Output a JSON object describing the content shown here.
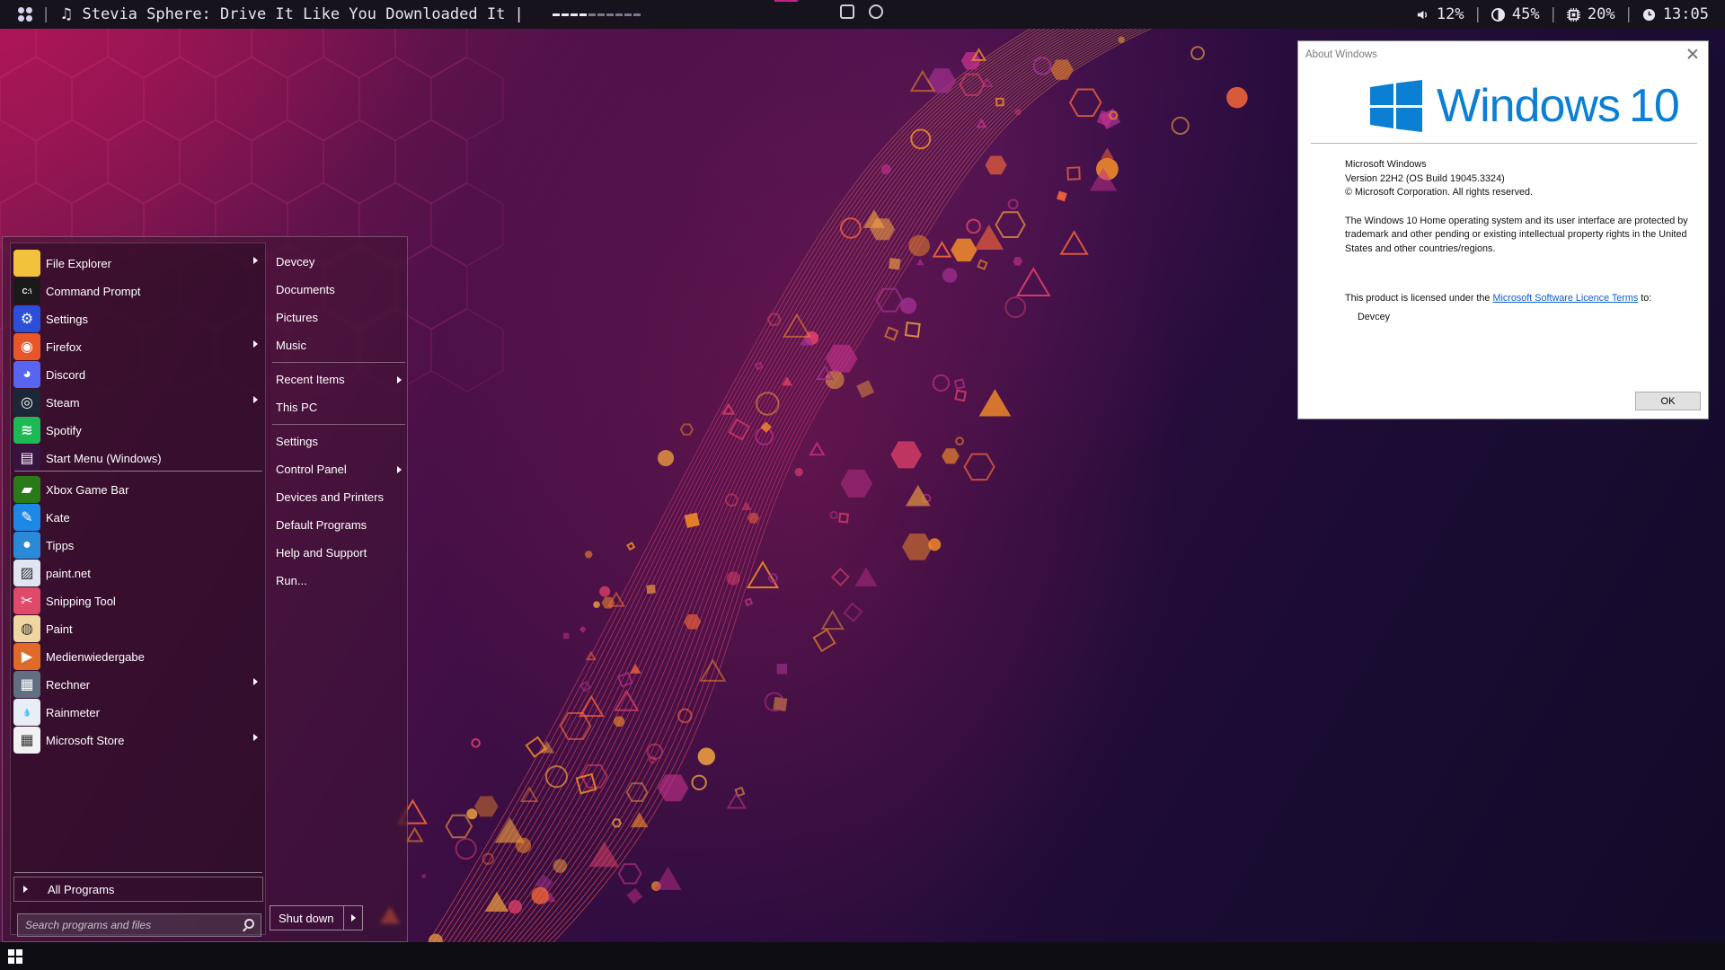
{
  "topbar": {
    "now_playing": "Stevia Sphere: Drive It Like You Downloaded It |",
    "progress": 0.4,
    "volume": "12%",
    "battery": "45%",
    "cpu": "20%",
    "clock": "13:05"
  },
  "start_menu": {
    "programs": [
      {
        "label": "File Explorer",
        "icon": "folder-icon",
        "submenu": true
      },
      {
        "label": "Command Prompt",
        "icon": "terminal-icon",
        "submenu": false
      },
      {
        "label": "Settings",
        "icon": "gear-icon",
        "submenu": false
      },
      {
        "label": "Firefox",
        "icon": "firefox-icon",
        "submenu": true
      },
      {
        "label": "Discord",
        "icon": "discord-icon",
        "submenu": false
      },
      {
        "label": "Steam",
        "icon": "steam-icon",
        "submenu": true
      },
      {
        "label": "Spotify",
        "icon": "spotify-icon",
        "submenu": false
      },
      {
        "label": "Start Menu (Windows)",
        "icon": "start-icon",
        "submenu": false
      },
      {
        "label": "Xbox Game Bar",
        "icon": "xbox-icon",
        "submenu": false
      },
      {
        "label": "Kate",
        "icon": "kate-icon",
        "submenu": false
      },
      {
        "label": "Tipps",
        "icon": "bulb-icon",
        "submenu": false
      },
      {
        "label": "paint.net",
        "icon": "paintnet-icon",
        "submenu": false
      },
      {
        "label": "Snipping Tool",
        "icon": "scissors-icon",
        "submenu": false
      },
      {
        "label": "Paint",
        "icon": "palette-icon",
        "submenu": false
      },
      {
        "label": "Medienwiedergabe",
        "icon": "play-icon",
        "submenu": false
      },
      {
        "label": "Rechner",
        "icon": "calculator-icon",
        "submenu": true
      },
      {
        "label": "Rainmeter",
        "icon": "drop-icon",
        "submenu": false
      },
      {
        "label": "Microsoft Store",
        "icon": "store-icon",
        "submenu": true
      }
    ],
    "all_programs": "All Programs",
    "search_placeholder": "Search programs and files",
    "places": [
      {
        "label": "Devcey",
        "submenu": false
      },
      {
        "label": "Documents",
        "submenu": false
      },
      {
        "label": "Pictures",
        "submenu": false
      },
      {
        "label": "Music",
        "submenu": false
      },
      {
        "label": "Recent Items",
        "submenu": true
      },
      {
        "label": "This PC",
        "submenu": false
      },
      {
        "label": "Settings",
        "submenu": false
      },
      {
        "label": "Control Panel",
        "submenu": true
      },
      {
        "label": "Devices and Printers",
        "submenu": false
      },
      {
        "label": "Default Programs",
        "submenu": false
      },
      {
        "label": "Help and Support",
        "submenu": false
      },
      {
        "label": "Run...",
        "submenu": false
      }
    ],
    "shutdown": "Shut down"
  },
  "about": {
    "title": "About Windows",
    "product": "Windows",
    "version_num": "10",
    "line1": "Microsoft Windows",
    "line2": "Version 22H2 (OS Build 19045.3324)",
    "line3": "© Microsoft Corporation. All rights reserved.",
    "protect": "The Windows 10 Home operating system and its user interface are protected by trademark and other pending or existing intellectual property rights in the United States and other countries/regions.",
    "license_prefix": "This product is licensed under the ",
    "license_link": "Microsoft Software Licence Terms",
    "license_suffix": " to:",
    "user": "Devcey",
    "ok": "OK"
  },
  "colors": {
    "accent": "#c4208a",
    "windows_blue": "#0a7fd4",
    "topbar": "#16131d"
  }
}
